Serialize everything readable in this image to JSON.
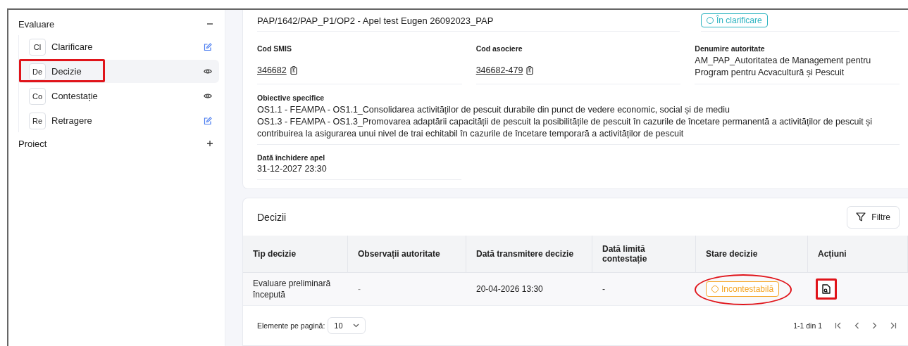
{
  "sidebar": {
    "sections": [
      {
        "title": "Evaluare",
        "expanded": true,
        "items": [
          {
            "abbr": "Cl",
            "label": "Clarificare",
            "kind": "edit",
            "selected": false,
            "annotated": false
          },
          {
            "abbr": "De",
            "label": "Decizie",
            "kind": "view",
            "selected": true,
            "annotated": true
          },
          {
            "abbr": "Co",
            "label": "Contestație",
            "kind": "view",
            "selected": false,
            "annotated": false
          },
          {
            "abbr": "Re",
            "label": "Retragere",
            "kind": "edit",
            "selected": false,
            "annotated": false
          }
        ]
      },
      {
        "title": "Proiect",
        "expanded": false
      }
    ]
  },
  "details": {
    "title": "PAP/1642/PAP_P1/OP2 - Apel test Eugen 26092023_PAP",
    "status": {
      "label": "În clarificare",
      "color": "#2bb3c0"
    },
    "fields": [
      {
        "label": "Cod SMIS",
        "kind": "copy",
        "lines": [
          "346682"
        ]
      },
      {
        "label": "Cod asociere",
        "kind": "copy",
        "lines": [
          "346682-479"
        ]
      },
      {
        "label": "Denumire autoritate",
        "kind": "text",
        "lines": [
          "AM_PAP_Autoritatea de Management pentru",
          "Program pentru Acvacultură și Pescuit"
        ]
      }
    ],
    "objectives": {
      "label": "Obiective specifice",
      "lines": [
        "OS1.1 - FEAMPA - OS1.1_Consolidarea activităților de pescuit durabile din punct de vedere economic, social și de mediu",
        "OS1.3 - FEAMPA - OS1.3_Promovarea adaptării capacității de pescuit la posibilitățile de pescuit în cazurile de încetare permanentă a activităților de pescuit și contribuirea la asigurarea unui nivel de trai echitabil în cazurile de încetare temporară a activităților de pescuit"
      ]
    },
    "closing": {
      "label": "Dată închidere apel",
      "value": "31-12-2027 23:30"
    }
  },
  "decisions": {
    "title": "Decizii",
    "filter_button": "Filtre",
    "columns": [
      "Tip decizie",
      "Observații autoritate",
      "Dată transmitere decizie",
      "Dată limită contestație",
      "Stare decizie",
      "Acțiuni"
    ],
    "rows": [
      {
        "type": "Evaluare preliminară începută",
        "observations": "-",
        "sent": "20-04-2026 13:30",
        "deadline": "-",
        "status": {
          "label": "Incontestabilă",
          "color": "#f5a524"
        },
        "status_annotated": true,
        "action_annotated": true
      }
    ],
    "pagination": {
      "label": "Elemente pe pagină:",
      "page_size": "10",
      "range": "1-1 din 1"
    }
  }
}
